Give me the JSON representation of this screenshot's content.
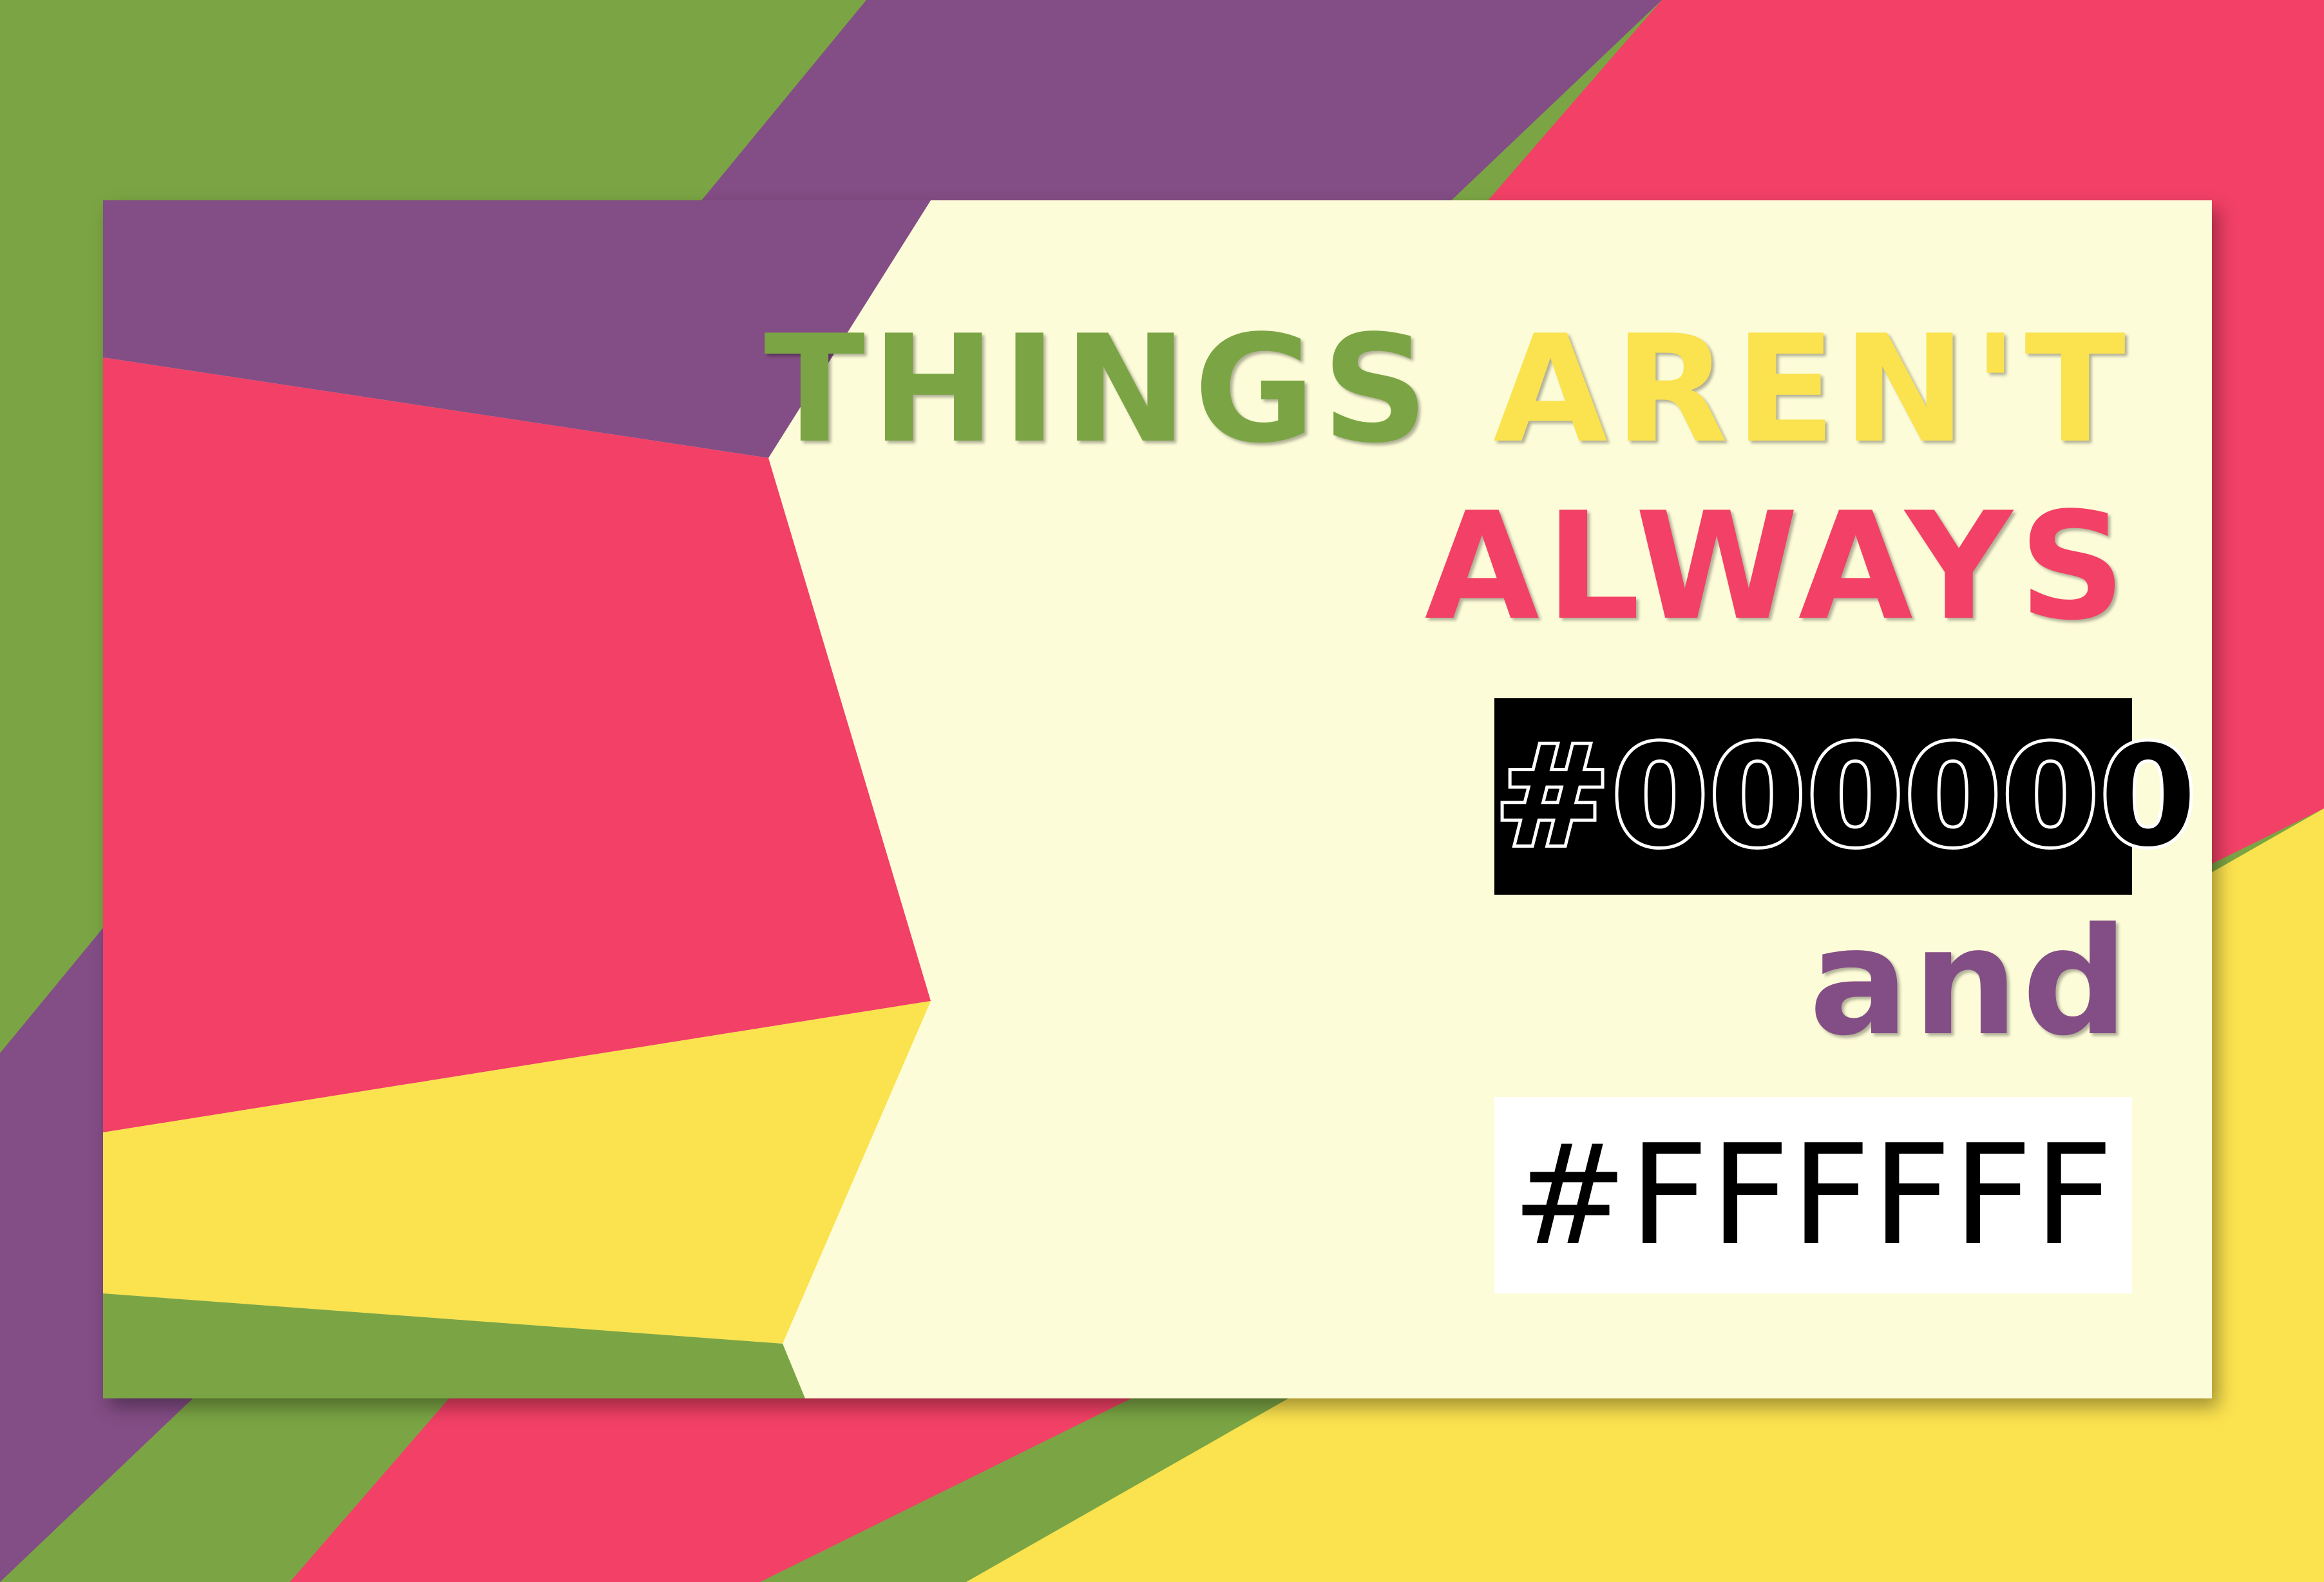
{
  "headline": {
    "word_1": "THINGS",
    "word_2": "AREN'T",
    "word_3": "ALWAYS"
  },
  "hex_black": "#000000",
  "conjunction": "and",
  "hex_white": "#FFFFFF",
  "colors": {
    "green": "#7ba544",
    "purple": "#834d85",
    "pink": "#f24066",
    "yellow": "#fbe24f",
    "cream": "#fdfcd8",
    "black": "#000000",
    "white": "#ffffff"
  }
}
